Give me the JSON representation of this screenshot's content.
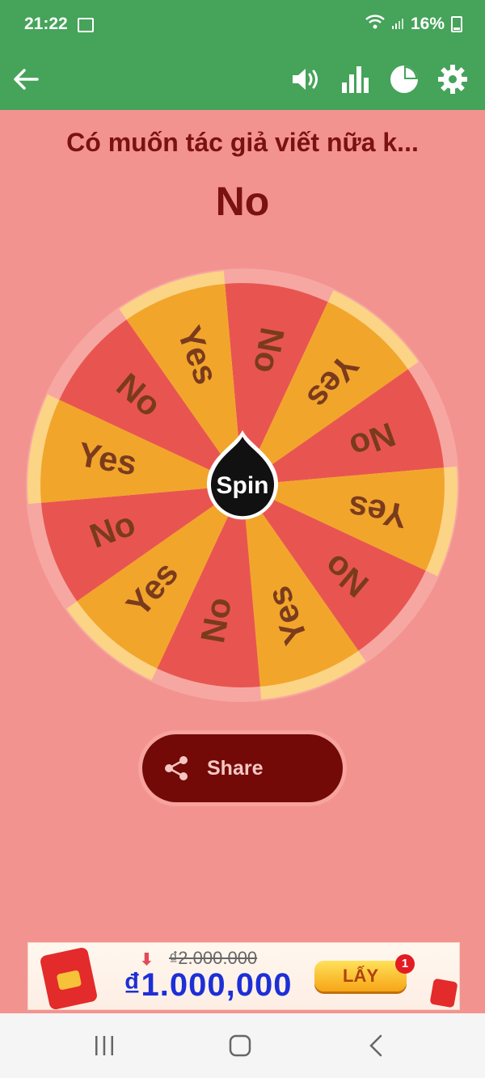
{
  "status": {
    "time": "21:22",
    "battery": "16%"
  },
  "appbar": {
    "icons": [
      "back-arrow-icon",
      "volume-icon",
      "bar-chart-icon",
      "pie-chart-icon",
      "gear-icon"
    ]
  },
  "question": "Có muốn tác giả viết nữa k...",
  "result": "No",
  "wheel": {
    "center_label": "Spin",
    "segments": [
      "No",
      "Yes",
      "No",
      "Yes",
      "No",
      "Yes",
      "No",
      "Yes",
      "No",
      "Yes",
      "No",
      "Yes"
    ],
    "colors": {
      "no": "#e85550",
      "yes": "#f2a52b",
      "text": "#7a3b1d",
      "rim": "#f7a7a2",
      "rim_accent": "#fbd486"
    }
  },
  "share": {
    "label": "Share"
  },
  "ad": {
    "old_price": "₫2.000.000",
    "new_price": "₫1.000,000",
    "button": "LẤY",
    "badge": "1"
  }
}
